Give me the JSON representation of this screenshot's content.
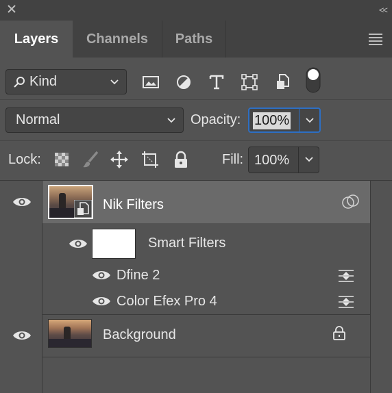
{
  "panel": {
    "collapse_glyph": "<<"
  },
  "tabs": [
    {
      "label": "Layers",
      "active": true
    },
    {
      "label": "Channels",
      "active": false
    },
    {
      "label": "Paths",
      "active": false
    }
  ],
  "filter_bar": {
    "kind_label": "Kind",
    "icons": [
      "image-filter-icon",
      "adjustment-filter-icon",
      "type-filter-icon",
      "shape-filter-icon",
      "smart-object-filter-icon",
      "filter-toggle-icon"
    ]
  },
  "blend": {
    "mode": "Normal",
    "opacity_label": "Opacity:",
    "opacity_value": "100%"
  },
  "lock": {
    "label": "Lock:",
    "fill_label": "Fill:",
    "fill_value": "100%"
  },
  "layers": [
    {
      "name": "Nik Filters",
      "type": "smart-object",
      "selected": true,
      "visible": true
    },
    {
      "name": "Background",
      "type": "pixel",
      "locked": true,
      "visible": true
    }
  ],
  "smart_filters": {
    "label": "Smart Filters",
    "items": [
      {
        "name": "Dfine 2"
      },
      {
        "name": "Color Efex Pro 4"
      }
    ]
  },
  "colors": {
    "panel_bg": "#535353",
    "tab_bar_bg": "#424242",
    "selected_layer_bg": "#6a6a6a",
    "focus_border": "#2d6fc4"
  }
}
